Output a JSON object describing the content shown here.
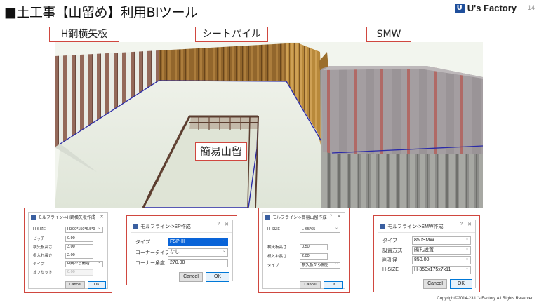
{
  "title": "■土工事【山留め】利用BIツール",
  "brand": {
    "name": "U's Factory",
    "page": "14"
  },
  "labels": {
    "h_steel": "H鋼横矢板",
    "sheet_pile": "シートパイル",
    "smw": "SMW",
    "simple": "簡易山留"
  },
  "dialogs": {
    "hsteel": {
      "title": "モルフライン->H鋼横矢板作成",
      "rows": [
        {
          "label": "H-SIZE",
          "value": "H300*150*6.5*9"
        },
        {
          "label": "ピッチ",
          "value": "0.90"
        },
        {
          "label": "横矢板高さ",
          "value": "3.00"
        },
        {
          "label": "根入れ長さ",
          "value": "2.00"
        },
        {
          "label": "タイプ",
          "value": "H鋼から開始"
        },
        {
          "label": "オフセット",
          "value": "0.00"
        }
      ],
      "cancel": "Cancel",
      "ok": "OK"
    },
    "sp": {
      "title": "モルフライン->SP作成",
      "rows": [
        {
          "label": "タイプ",
          "value": "FSP-III"
        },
        {
          "label": "コーナータイプ",
          "value": "なし"
        },
        {
          "label": "コーナー角度",
          "value": "270.00"
        }
      ],
      "cancel": "Cancel",
      "ok": "OK"
    },
    "simple": {
      "title": "モルフライン->簡易山留作成",
      "rows": [
        {
          "label": "H-SIZE",
          "value": "L-65*65"
        },
        {
          "label": "横矢板高さ",
          "value": "0.50"
        },
        {
          "label": "根入れ長さ",
          "value": "2.00"
        },
        {
          "label": "タイプ",
          "value": "横矢板から開始"
        }
      ],
      "cancel": "Cancel",
      "ok": "OK"
    },
    "smw": {
      "title": "モルフライン->SMW作成",
      "rows": [
        {
          "label": "タイプ",
          "value": "850SMW"
        },
        {
          "label": "設置方式",
          "value": "隔孔設置"
        },
        {
          "label": "削孔径",
          "value": "850.00"
        },
        {
          "label": "H-SIZE",
          "value": "H-350x175x7x11"
        }
      ],
      "cancel": "Cancel",
      "ok": "OK"
    }
  },
  "copyright": "Copyright©2014-23 U's Factory All Rights Reserved.",
  "colors": {
    "frame": "#d0473f",
    "accent": "#0a64d8"
  }
}
